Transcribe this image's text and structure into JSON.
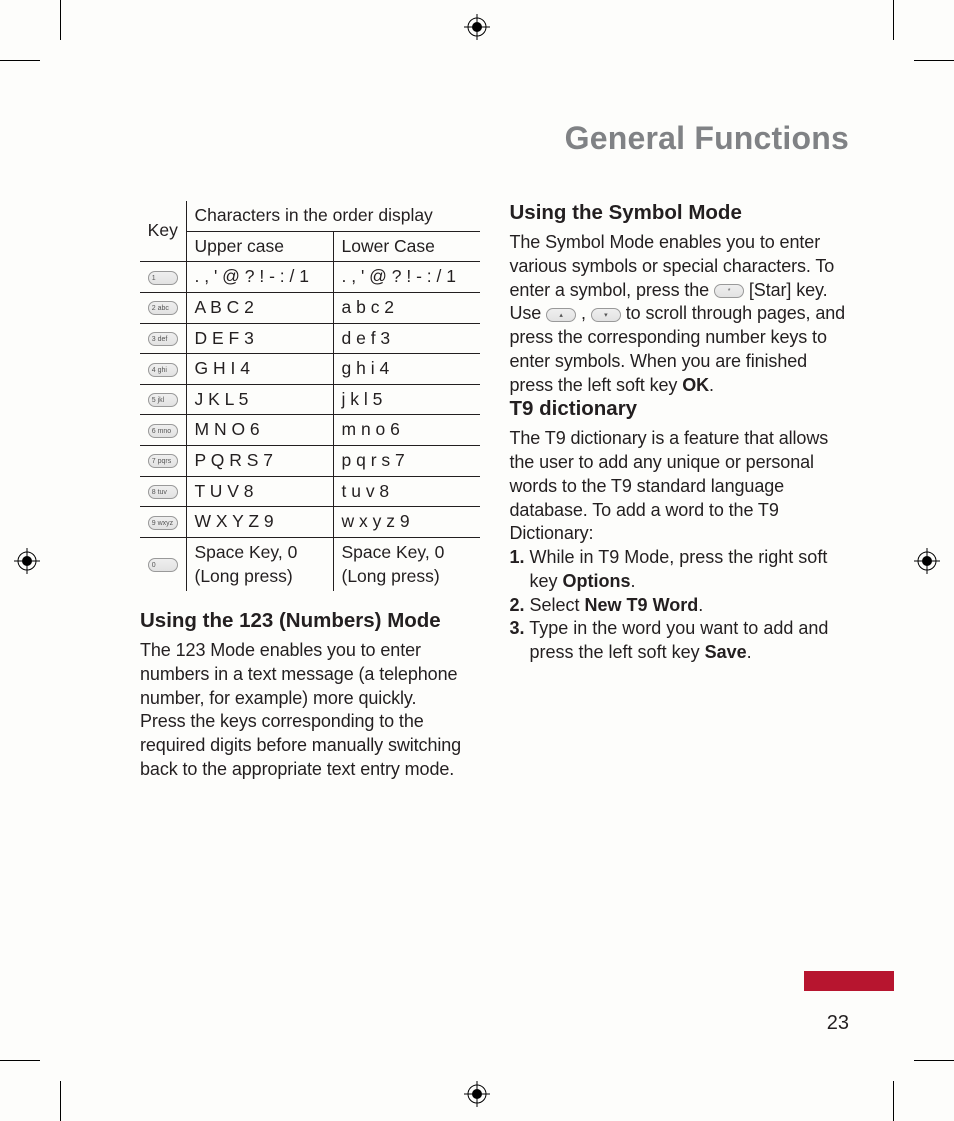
{
  "title": "General Functions",
  "page_num": "23",
  "table": {
    "key_label": "Key",
    "header_span": "Characters in the order display",
    "upper_label": "Upper case",
    "lower_label": "Lower Case",
    "rows": [
      {
        "key": "1",
        "upper": ". , ' @ ? ! - : / 1",
        "lower": ". , ' @ ? ! - : / 1"
      },
      {
        "key": "2 abc",
        "upper": "A B C 2",
        "lower": "a b c 2"
      },
      {
        "key": "3 def",
        "upper": "D E F 3",
        "lower": "d e f 3"
      },
      {
        "key": "4 ghi",
        "upper": "G H I 4",
        "lower": "g h i 4"
      },
      {
        "key": "5 jkl",
        "upper": "J K L 5",
        "lower": "j k l 5"
      },
      {
        "key": "6 mno",
        "upper": "M N O 6",
        "lower": "m n o 6"
      },
      {
        "key": "7 pqrs",
        "upper": "P Q R S 7",
        "lower": "p q r s 7"
      },
      {
        "key": "8 tuv",
        "upper": "T U V 8",
        "lower": "t u v 8"
      },
      {
        "key": "9 wxyz",
        "upper": "W X Y Z 9",
        "lower": "w x y z 9"
      },
      {
        "key": "0",
        "upper": "Space Key, 0 (Long press)",
        "lower": "Space Key, 0 (Long press)"
      }
    ]
  },
  "sec123": {
    "heading": "Using the 123 (Numbers) Mode",
    "p1": "The 123 Mode enables you to enter numbers in a text message (a telephone number, for example) more quickly.",
    "p2": "Press the keys corresponding to the required digits before manually switching back to the appropriate text entry mode."
  },
  "secSymbol": {
    "heading": "Using the Symbol Mode",
    "p1a": "The Symbol Mode enables you to enter various symbols or special characters. To enter a symbol, press the ",
    "p1b": " [Star] key.",
    "p2a": "Use ",
    "p2b": " , ",
    "p2c": " to scroll through pages, and press the corresponding number keys to enter symbols. When you are finished press the left soft key ",
    "p2ok": "OK",
    "p2d": "."
  },
  "secT9": {
    "heading": "T9 dictionary",
    "p1": "The T9 dictionary is a feature that allows the user to add any unique or personal words to the T9 standard language database. To add a word to the T9 Dictionary:",
    "steps": [
      {
        "n": "1.",
        "before": " While in T9 Mode, press the right soft key ",
        "bold": "Options",
        "after": "."
      },
      {
        "n": "2.",
        "before": " Select ",
        "bold": "New T9 Word",
        "after": "."
      },
      {
        "n": "3.",
        "before": " Type in the word you want to add and press the left soft key ",
        "bold": "Save",
        "after": "."
      }
    ]
  },
  "icons": {
    "star_key": "*",
    "up_key": "▴",
    "down_key": "▾"
  }
}
